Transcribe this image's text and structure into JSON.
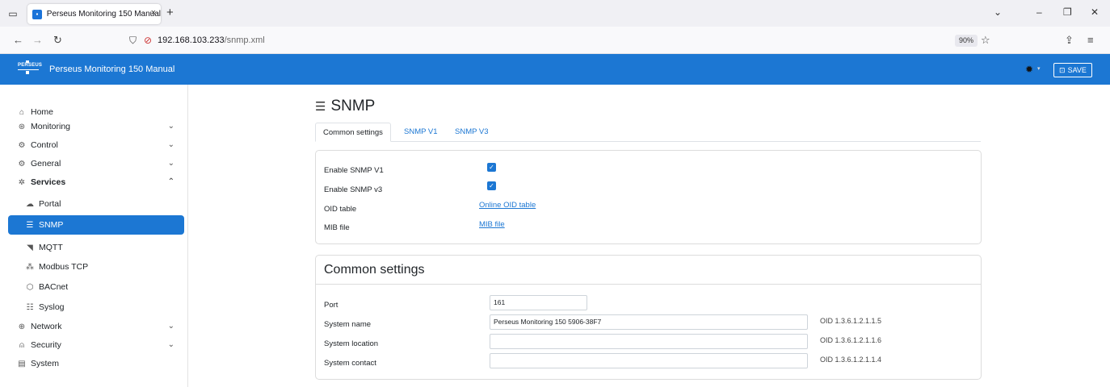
{
  "browser": {
    "tab_title": "Perseus Monitoring 150 Manual",
    "tab_close": "×",
    "new_tab": "+",
    "url_host": "192.168.103.233",
    "url_path": "/snmp.xml",
    "zoom": "90%"
  },
  "header": {
    "logo_text": "PERSEUS",
    "title": "Perseus Monitoring 150 Manual",
    "save_label": "SAVE",
    "brand_color": "#1c77d3"
  },
  "sidebar": {
    "items": [
      {
        "label": "Home",
        "icon": "home-icon"
      },
      {
        "label": "Monitoring",
        "icon": "gauge-icon",
        "expandable": true
      },
      {
        "label": "Control",
        "icon": "control-icon",
        "expandable": true
      },
      {
        "label": "General",
        "icon": "gear-icon",
        "expandable": true
      },
      {
        "label": "Services",
        "icon": "services-icon",
        "expandable": true,
        "expanded": true
      },
      {
        "label": "Portal",
        "icon": "cloud-icon"
      },
      {
        "label": "SNMP",
        "icon": "snmp-icon",
        "active": true
      },
      {
        "label": "MQTT",
        "icon": "signal-icon"
      },
      {
        "label": "Modbus TCP",
        "icon": "network-tree-icon"
      },
      {
        "label": "BACnet",
        "icon": "hexagon-icon"
      },
      {
        "label": "Syslog",
        "icon": "list-icon"
      },
      {
        "label": "Network",
        "icon": "globe-icon",
        "expandable": true
      },
      {
        "label": "Security",
        "icon": "lock-icon",
        "expandable": true
      },
      {
        "label": "System",
        "icon": "system-icon"
      }
    ]
  },
  "main": {
    "title": "SNMP",
    "tabs": [
      "Common settings",
      "SNMP V1",
      "SNMP V3"
    ],
    "active_tab": "Common settings",
    "general": {
      "enable_v1_label": "Enable SNMP V1",
      "enable_v1_checked": true,
      "enable_v3_label": "Enable SNMP v3",
      "enable_v3_checked": true,
      "oid_table_label": "OID table",
      "oid_table_link": "Online OID table",
      "mib_file_label": "MIB file",
      "mib_file_link": "MIB file"
    },
    "common": {
      "title": "Common settings",
      "port_label": "Port",
      "port_value": "161",
      "system_name_label": "System name",
      "system_name_value": "Perseus Monitoring 150 5906-38F7",
      "system_name_oid": "OID 1.3.6.1.2.1.1.5",
      "system_location_label": "System location",
      "system_location_value": "",
      "system_location_oid": "OID 1.3.6.1.2.1.1.6",
      "system_contact_label": "System contact",
      "system_contact_value": "",
      "system_contact_oid": "OID 1.3.6.1.2.1.1.4"
    }
  }
}
